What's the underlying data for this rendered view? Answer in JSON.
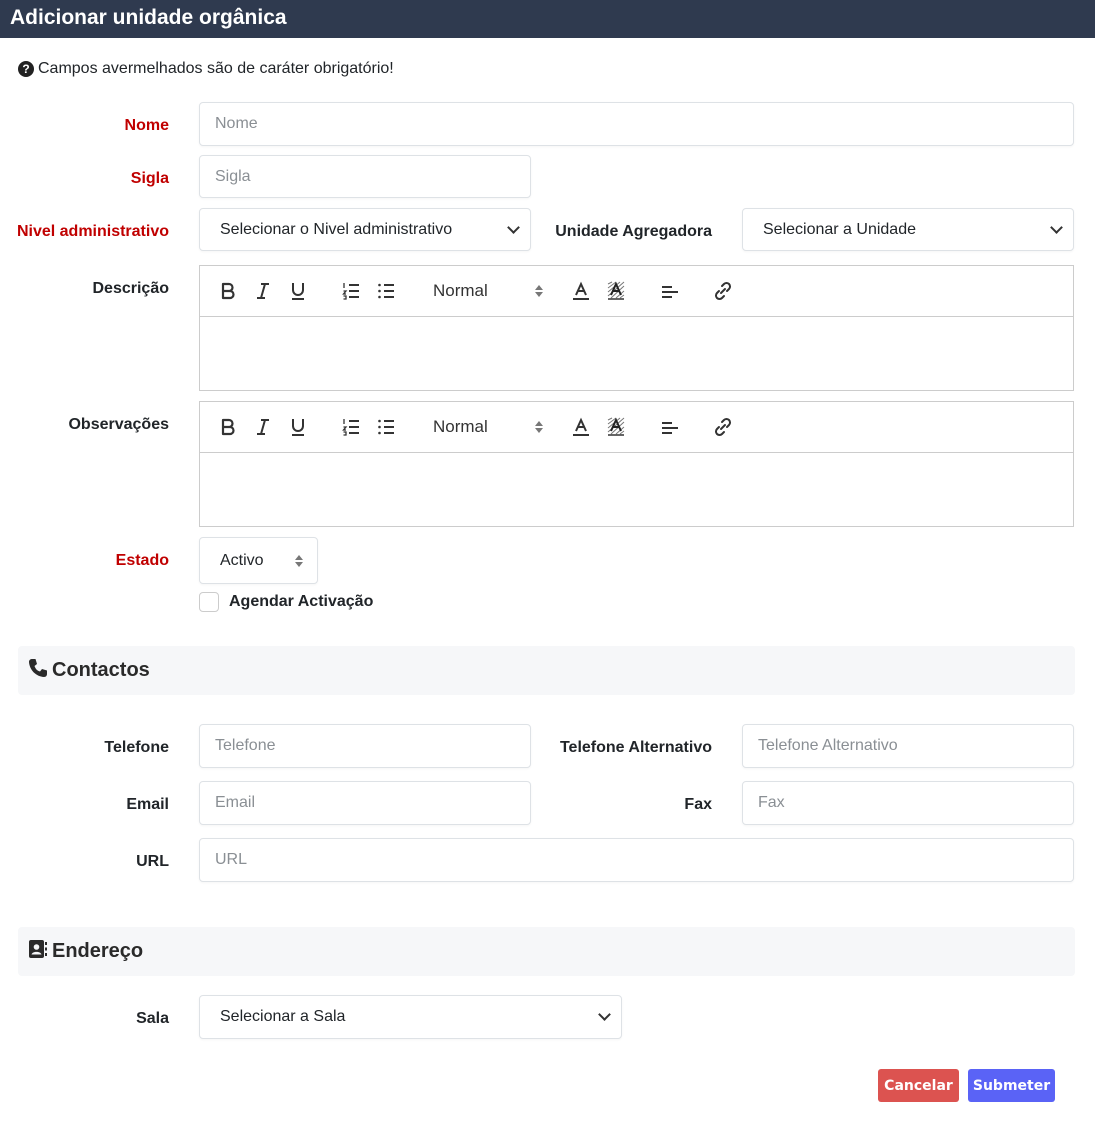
{
  "window": {
    "title": "Adicionar unidade orgânica"
  },
  "hint": {
    "text": "Campos avermelhados são de caráter obrigatório!",
    "icon": "question-circle-icon"
  },
  "fields": {
    "nome": {
      "label": "Nome",
      "placeholder": "Nome"
    },
    "sigla": {
      "label": "Sigla",
      "placeholder": "Sigla"
    },
    "nivel": {
      "label": "Nivel administrativo",
      "value": "Selecionar o Nivel administrativo"
    },
    "agregadora": {
      "label": "Unidade Agregadora",
      "value": "Selecionar a Unidade"
    },
    "descricao": {
      "label": "Descrição"
    },
    "observacoes": {
      "label": "Observações"
    },
    "estado": {
      "label": "Estado",
      "value": "Activo"
    },
    "agendar": {
      "label": "Agendar Activação",
      "checked": false
    }
  },
  "editor": {
    "header_value": "Normal",
    "tools": [
      "bold-icon",
      "italic-icon",
      "underline-icon",
      "ordered-list-icon",
      "bullet-list-icon",
      "color-icon",
      "background-icon",
      "align-icon",
      "link-icon"
    ]
  },
  "contactos": {
    "title": "Contactos",
    "icon": "phone-icon",
    "telefone": {
      "label": "Telefone",
      "placeholder": "Telefone"
    },
    "telefone_alt": {
      "label": "Telefone Alternativo",
      "placeholder": "Telefone Alternativo"
    },
    "email": {
      "label": "Email",
      "placeholder": "Email"
    },
    "fax": {
      "label": "Fax",
      "placeholder": "Fax"
    },
    "url": {
      "label": "URL",
      "placeholder": "URL"
    }
  },
  "endereco": {
    "title": "Endereço",
    "icon": "address-book-icon",
    "sala": {
      "label": "Sala",
      "value": "Selecionar a Sala"
    }
  },
  "actions": {
    "cancel": "Cancelar",
    "submit": "Submeter"
  },
  "colors": {
    "required": "#c00000",
    "header_bg": "#2f3a4f",
    "cancel": "#dc5350",
    "submit": "#5a63f6"
  }
}
